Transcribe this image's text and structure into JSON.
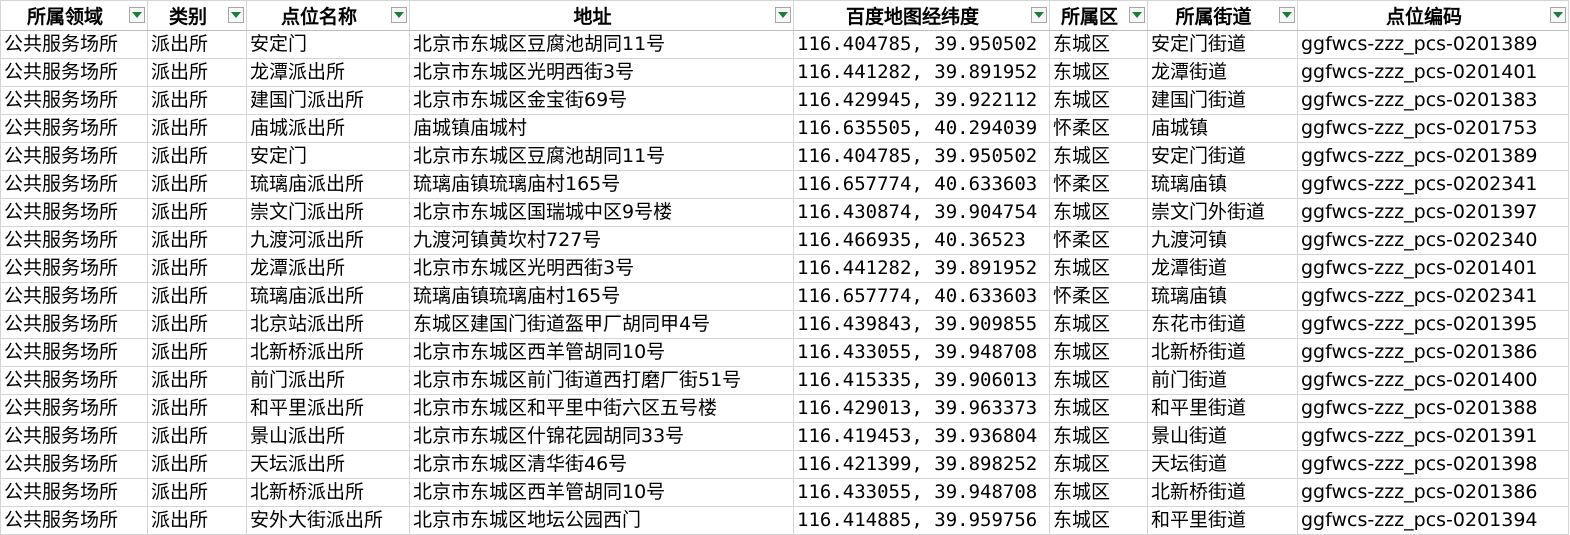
{
  "theme": {
    "filter_arrow_color": "#1e7b3c",
    "grid_color": "#d4d4d4"
  },
  "columns": [
    {
      "key": "field",
      "label": "所属领域"
    },
    {
      "key": "type",
      "label": "类别"
    },
    {
      "key": "name",
      "label": "点位名称"
    },
    {
      "key": "address",
      "label": "地址"
    },
    {
      "key": "coord",
      "label": "百度地图经纬度"
    },
    {
      "key": "district",
      "label": "所属区"
    },
    {
      "key": "street",
      "label": "所属街道"
    },
    {
      "key": "code",
      "label": "点位编码"
    }
  ],
  "rows": [
    [
      "公共服务场所",
      "派出所",
      "安定门",
      "北京市东城区豆腐池胡同11号",
      "116.404785, 39.950502",
      "东城区",
      "安定门街道",
      "ggfwcs-zzz_pcs-0201389"
    ],
    [
      "公共服务场所",
      "派出所",
      "龙潭派出所",
      "北京市东城区光明西街3号",
      "116.441282, 39.891952",
      "东城区",
      "龙潭街道",
      "ggfwcs-zzz_pcs-0201401"
    ],
    [
      "公共服务场所",
      "派出所",
      "建国门派出所",
      "北京市东城区金宝街69号",
      "116.429945, 39.922112",
      "东城区",
      "建国门街道",
      "ggfwcs-zzz_pcs-0201383"
    ],
    [
      "公共服务场所",
      "派出所",
      "庙城派出所",
      "庙城镇庙城村",
      "116.635505, 40.294039",
      "怀柔区",
      "庙城镇",
      "ggfwcs-zzz_pcs-0201753"
    ],
    [
      "公共服务场所",
      "派出所",
      "安定门",
      "北京市东城区豆腐池胡同11号",
      "116.404785, 39.950502",
      "东城区",
      "安定门街道",
      "ggfwcs-zzz_pcs-0201389"
    ],
    [
      "公共服务场所",
      "派出所",
      "琉璃庙派出所",
      "琉璃庙镇琉璃庙村165号",
      "116.657774, 40.633603",
      "怀柔区",
      "琉璃庙镇",
      "ggfwcs-zzz_pcs-0202341"
    ],
    [
      "公共服务场所",
      "派出所",
      "崇文门派出所",
      "北京市东城区国瑞城中区9号楼",
      "116.430874, 39.904754",
      "东城区",
      "崇文门外街道",
      "ggfwcs-zzz_pcs-0201397"
    ],
    [
      "公共服务场所",
      "派出所",
      "九渡河派出所",
      "九渡河镇黄坎村727号",
      "116.466935, 40.36523",
      "怀柔区",
      "九渡河镇",
      "ggfwcs-zzz_pcs-0202340"
    ],
    [
      "公共服务场所",
      "派出所",
      "龙潭派出所",
      "北京市东城区光明西街3号",
      "116.441282, 39.891952",
      "东城区",
      "龙潭街道",
      "ggfwcs-zzz_pcs-0201401"
    ],
    [
      "公共服务场所",
      "派出所",
      "琉璃庙派出所",
      "琉璃庙镇琉璃庙村165号",
      "116.657774, 40.633603",
      "怀柔区",
      "琉璃庙镇",
      "ggfwcs-zzz_pcs-0202341"
    ],
    [
      "公共服务场所",
      "派出所",
      "北京站派出所",
      "东城区建国门街道盔甲厂胡同甲4号",
      "116.439843, 39.909855",
      "东城区",
      "东花市街道",
      "ggfwcs-zzz_pcs-0201395"
    ],
    [
      "公共服务场所",
      "派出所",
      "北新桥派出所",
      "北京市东城区西羊管胡同10号",
      "116.433055, 39.948708",
      "东城区",
      "北新桥街道",
      "ggfwcs-zzz_pcs-0201386"
    ],
    [
      "公共服务场所",
      "派出所",
      "前门派出所",
      "北京市东城区前门街道西打磨厂街51号",
      "116.415335, 39.906013",
      "东城区",
      "前门街道",
      "ggfwcs-zzz_pcs-0201400"
    ],
    [
      "公共服务场所",
      "派出所",
      "和平里派出所",
      "北京市东城区和平里中街六区五号楼",
      "116.429013, 39.963373",
      "东城区",
      "和平里街道",
      "ggfwcs-zzz_pcs-0201388"
    ],
    [
      "公共服务场所",
      "派出所",
      "景山派出所",
      "北京市东城区什锦花园胡同33号",
      "116.419453, 39.936804",
      "东城区",
      "景山街道",
      "ggfwcs-zzz_pcs-0201391"
    ],
    [
      "公共服务场所",
      "派出所",
      "天坛派出所",
      "北京市东城区清华街46号",
      "116.421399, 39.898252",
      "东城区",
      "天坛街道",
      "ggfwcs-zzz_pcs-0201398"
    ],
    [
      "公共服务场所",
      "派出所",
      "北新桥派出所",
      "北京市东城区西羊管胡同10号",
      "116.433055, 39.948708",
      "东城区",
      "北新桥街道",
      "ggfwcs-zzz_pcs-0201386"
    ],
    [
      "公共服务场所",
      "派出所",
      "安外大街派出所",
      "北京市东城区地坛公园西门",
      "116.414885, 39.959756",
      "东城区",
      "和平里街道",
      "ggfwcs-zzz_pcs-0201394"
    ]
  ]
}
